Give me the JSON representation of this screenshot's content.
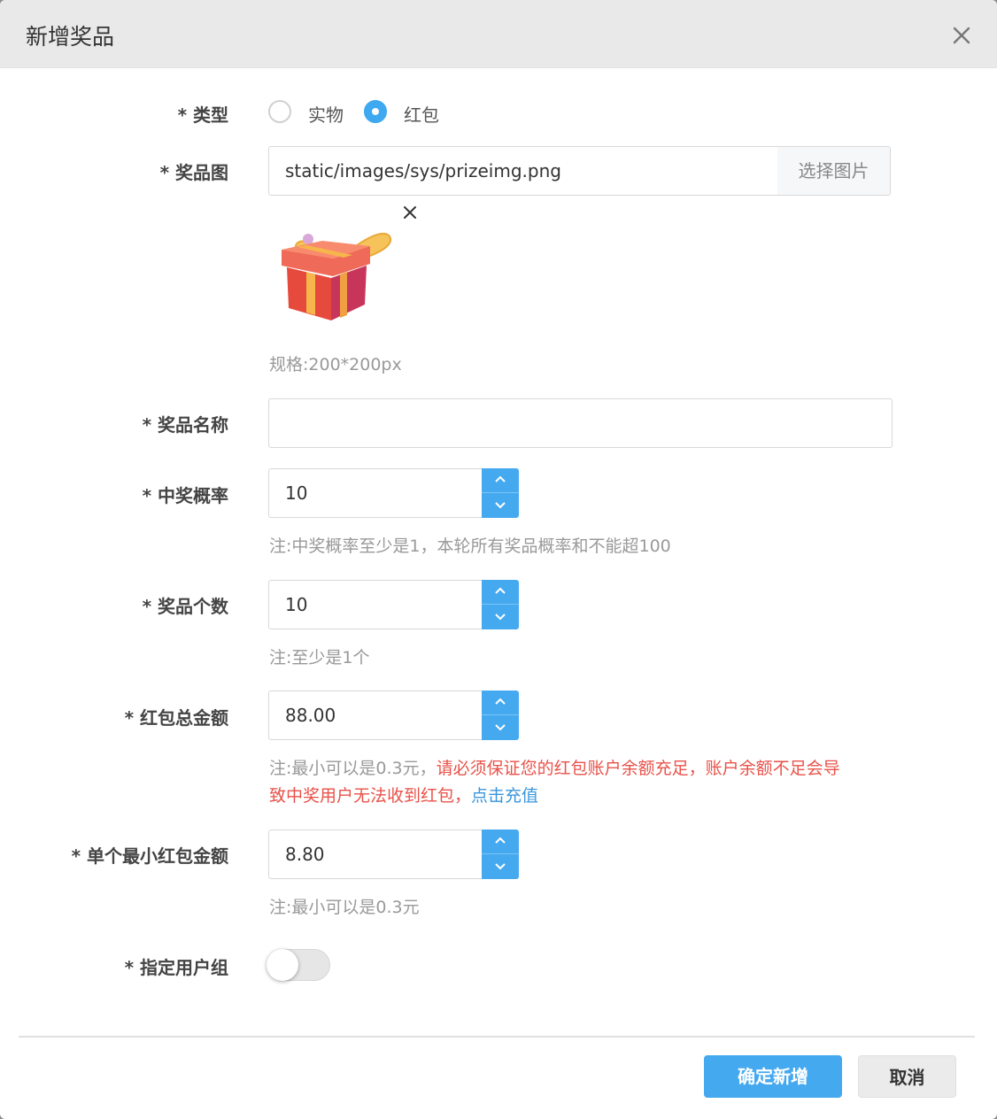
{
  "dialog": {
    "title": "新增奖品",
    "close_icon": "close-icon"
  },
  "fields": {
    "type": {
      "label": "* 类型",
      "options": [
        "实物",
        "红包"
      ],
      "selected": "红包"
    },
    "image": {
      "label": "* 奖品图",
      "value": "static/images/sys/prizeimg.png",
      "button_label": "选择图片",
      "thumbnail_icon": "gift-box-icon",
      "spec_hint": "规格:200*200px"
    },
    "prize_name": {
      "label": "* 奖品名称",
      "value": ""
    },
    "probability": {
      "label": "* 中奖概率",
      "value": "10",
      "hint": "注:中奖概率至少是1，本轮所有奖品概率和不能超100"
    },
    "quantity": {
      "label": "* 奖品个数",
      "value": "10",
      "hint": "注:至少是1个"
    },
    "total_amount": {
      "label": "* 红包总金额",
      "value": "88.00",
      "hint_prefix": "注:最小可以是0.3元，",
      "hint_warning_1": "请必须保证您的红包账户余额充足，账户余额不足会导",
      "hint_warning_2": "致中奖用户无法收到红包，",
      "hint_link": "点击充值"
    },
    "min_amount": {
      "label": "* 单个最小红包金额",
      "value": "8.80",
      "hint": "注:最小可以是0.3元"
    },
    "user_group": {
      "label": "* 指定用户组",
      "enabled": false
    }
  },
  "footer": {
    "confirm_label": "确定新增",
    "cancel_label": "取消"
  },
  "colors": {
    "primary": "#45a9f0",
    "warning": "#e9524a",
    "link": "#3a96dd"
  }
}
